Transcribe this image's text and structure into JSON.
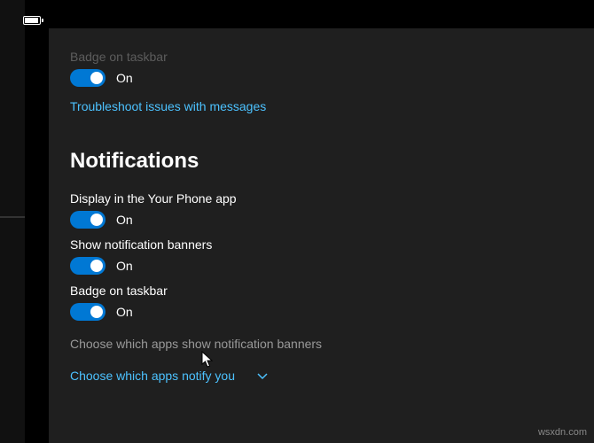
{
  "messages": {
    "truncated_label": "Badge on taskbar",
    "toggle_state": "On",
    "troubleshoot_link": "Troubleshoot issues with messages"
  },
  "notifications": {
    "heading": "Notifications",
    "settings": [
      {
        "label": "Display in the Your Phone app",
        "state": "On"
      },
      {
        "label": "Show notification banners",
        "state": "On"
      },
      {
        "label": "Badge on taskbar",
        "state": "On"
      }
    ],
    "sub_heading": "Choose which apps show notification banners",
    "expand_link": "Choose which apps notify you"
  },
  "watermark": "wsxdn.com"
}
